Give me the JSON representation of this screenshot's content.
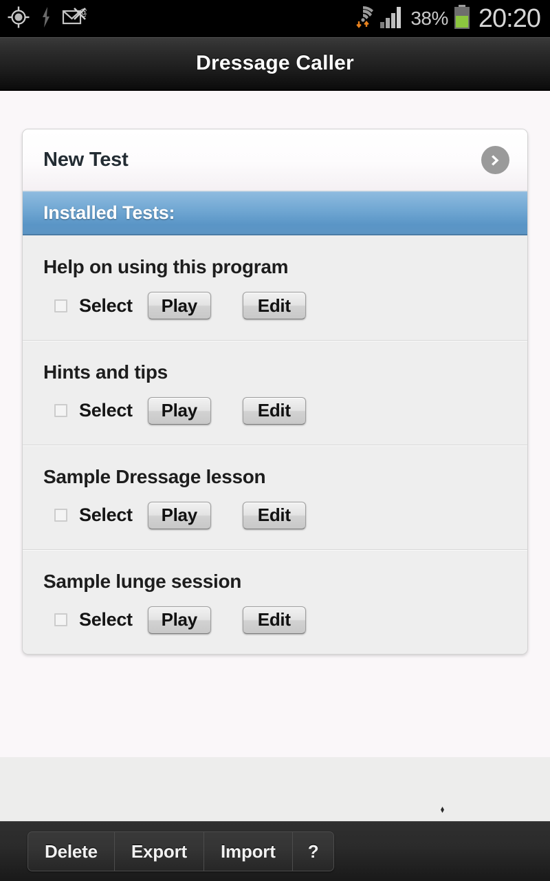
{
  "status_bar": {
    "icons": [
      "gps-icon",
      "flash-icon",
      "email-icon"
    ],
    "wifi_icon": "wifi-sync-icon",
    "signal_icon": "signal-bars-icon",
    "battery_percent": "38%",
    "battery_icon": "battery-icon",
    "time": "20:20"
  },
  "title_bar": {
    "title": "Dressage Caller"
  },
  "new_test": {
    "label": "New Test",
    "chevron_icon": "chevron-right-icon"
  },
  "section": {
    "header": "Installed Tests:"
  },
  "common": {
    "select_label": "Select",
    "play_label": "Play",
    "edit_label": "Edit"
  },
  "tests": [
    {
      "name": "Help on using this program",
      "select_label": "Select",
      "play_label": "Play",
      "edit_label": "Edit",
      "checked": false
    },
    {
      "name": "Hints and tips",
      "select_label": "Select",
      "play_label": "Play",
      "edit_label": "Edit",
      "checked": false
    },
    {
      "name": "Sample Dressage lesson",
      "select_label": "Select",
      "play_label": "Play",
      "edit_label": "Edit",
      "checked": false
    },
    {
      "name": "Sample lunge session",
      "select_label": "Select",
      "play_label": "Play",
      "edit_label": "Edit",
      "checked": false
    }
  ],
  "bottom_bar": {
    "buttons": [
      {
        "label": "Delete"
      },
      {
        "label": "Export"
      },
      {
        "label": "Import"
      },
      {
        "label": "?"
      }
    ]
  },
  "colors": {
    "accent_blue": "#6fa6d2",
    "card_bg": "#eeeeee",
    "page_bg": "#faf7f9",
    "lower_bg": "#ededec",
    "bar_dark": "#2b2b2b",
    "status_black": "#000000",
    "battery_green": "#8cc63f"
  }
}
